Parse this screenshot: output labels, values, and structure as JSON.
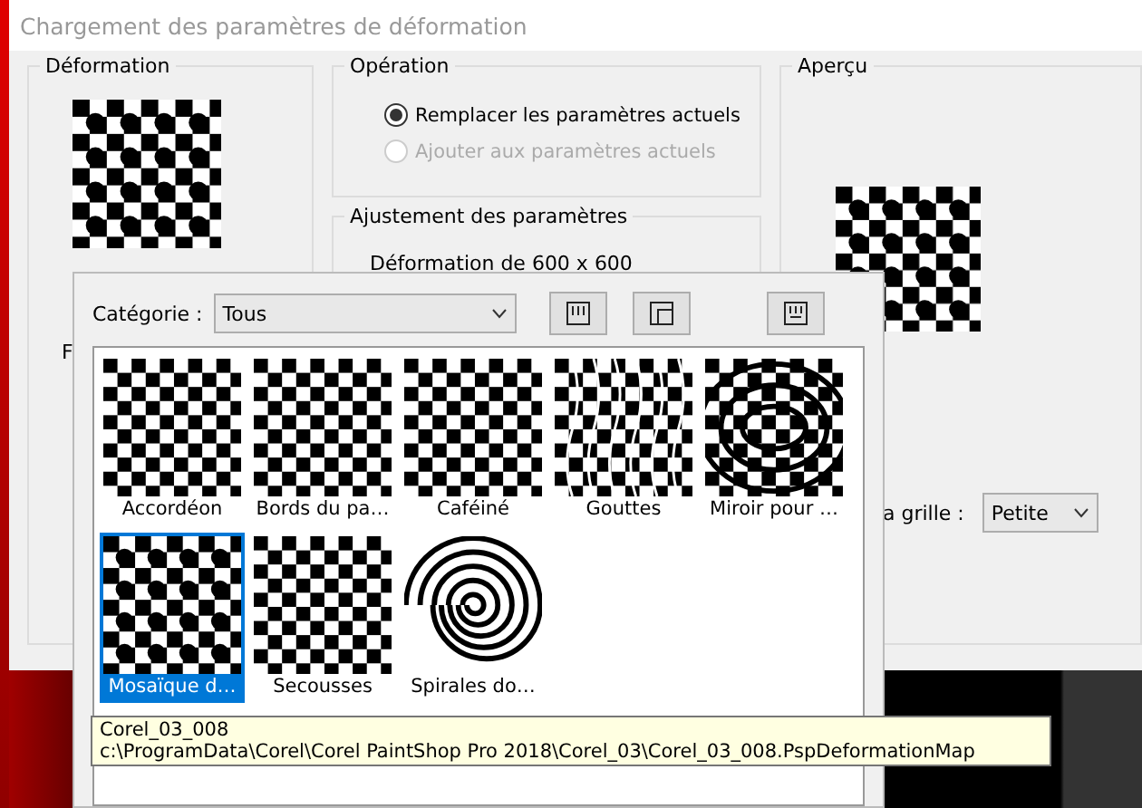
{
  "window": {
    "title": "Chargement des paramètres de déformation"
  },
  "deformation_panel": {
    "title": "Déformation",
    "partial_label": "F"
  },
  "operation": {
    "title": "Opération",
    "options": [
      {
        "label": "Remplacer les paramètres actuels",
        "selected": true,
        "disabled": false
      },
      {
        "label": "Ajouter aux paramètres actuels",
        "selected": false,
        "disabled": true
      }
    ]
  },
  "adjustment": {
    "title": "Ajustement des paramètres",
    "text": "Déformation de 600 x 600"
  },
  "preview": {
    "title": "Aperçu",
    "grid_label": "a grille :",
    "grid_size": "Petite"
  },
  "browser": {
    "category_label": "Catégorie :",
    "category": "Tous",
    "presets": [
      {
        "name": "Accordéon",
        "kind": "checker",
        "selected": false
      },
      {
        "name": "Bords du pa…",
        "kind": "checker",
        "selected": false
      },
      {
        "name": "Caféiné",
        "kind": "checker",
        "selected": false
      },
      {
        "name": "Gouttes",
        "kind": "wavy",
        "selected": false
      },
      {
        "name": "Miroir pour …",
        "kind": "warp",
        "selected": false
      },
      {
        "name": "Mosaïque d…",
        "kind": "blur",
        "selected": true
      },
      {
        "name": "Secousses",
        "kind": "checker",
        "selected": false
      },
      {
        "name": "Spirales do…",
        "kind": "spiral",
        "selected": false
      }
    ]
  },
  "tooltip": {
    "lines": [
      "Corel_03_008",
      "c:\\ProgramData\\Corel\\Corel PaintShop Pro 2018\\Corel_03\\Corel_03_008.PspDeformationMap"
    ]
  }
}
